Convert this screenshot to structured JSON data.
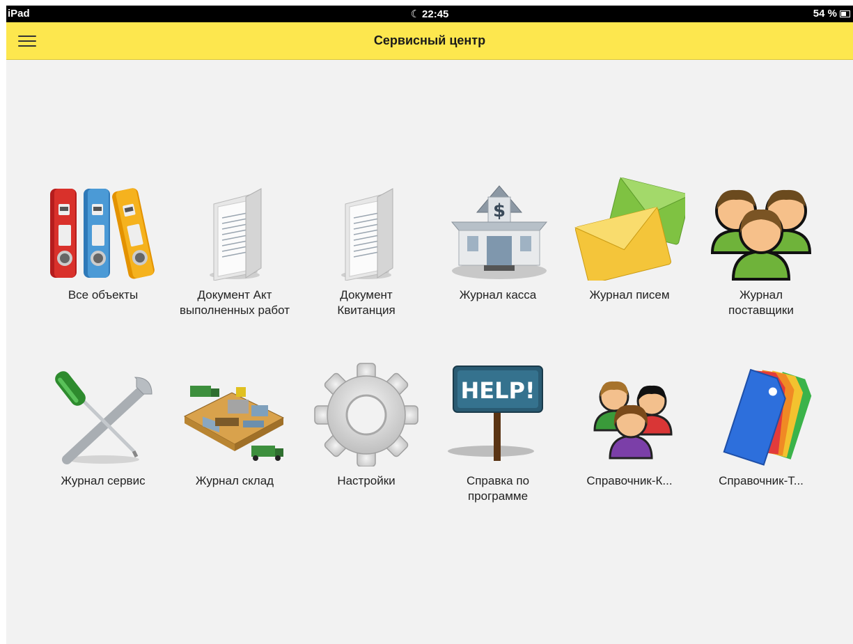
{
  "status_bar": {
    "device": "iPad",
    "time": "22:45",
    "battery": "54 %"
  },
  "header": {
    "title": "Сервисный центр"
  },
  "tiles": [
    {
      "label": "Все объекты",
      "icon": "binders-icon"
    },
    {
      "label": "Документ Акт выполненных работ",
      "icon": "document-folder-icon"
    },
    {
      "label": "Документ Квитанция",
      "icon": "document-folder-icon"
    },
    {
      "label": "Журнал касса",
      "icon": "bank-icon"
    },
    {
      "label": "Журнал писем",
      "icon": "envelopes-icon"
    },
    {
      "label": "Журнал поставщики",
      "icon": "users-group-icon"
    },
    {
      "label": "Журнал сервис",
      "icon": "tools-icon"
    },
    {
      "label": "Журнал склад",
      "icon": "warehouse-icon"
    },
    {
      "label": "Настройки",
      "icon": "gear-icon"
    },
    {
      "label": "Справка по программе",
      "icon": "help-sign-icon"
    },
    {
      "label": "Справочник-К...",
      "icon": "contacts-icon"
    },
    {
      "label": "Справочник-Т...",
      "icon": "tags-icon"
    }
  ],
  "help_sign_text": "HELP!"
}
